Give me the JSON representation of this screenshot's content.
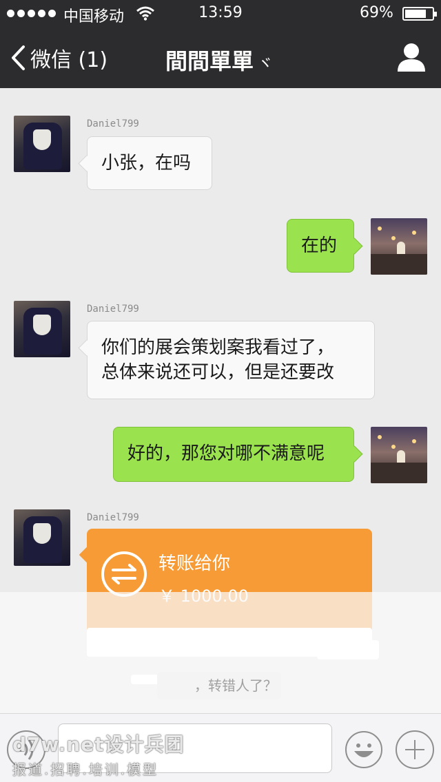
{
  "status_bar": {
    "carrier": "中国移动",
    "time": "13:59",
    "battery": "69%",
    "battery_level": 0.69,
    "icons": [
      "signal-dots-icon",
      "wifi-icon",
      "battery-icon"
    ]
  },
  "nav": {
    "back_label": "微信 (1)",
    "title": "間間單單",
    "title_suffix": "ヾ",
    "icons": [
      "chevron-left-icon",
      "profile-icon"
    ]
  },
  "messages": [
    {
      "sender": "Daniel799",
      "text": "小张，在吗",
      "direction": "in"
    },
    {
      "text": "在的",
      "direction": "out"
    },
    {
      "sender": "Daniel799",
      "text_lines": [
        "你们的展会策划案我看过了，",
        "总体来说还可以，但是还要改"
      ],
      "direction": "in"
    },
    {
      "text": "好的，那您对哪不满意呢",
      "direction": "out"
    },
    {
      "sender": "Daniel799",
      "type": "transfer",
      "label": "转账给你",
      "amount": "￥ 1000.00",
      "direction": "in"
    }
  ],
  "partial_message": "，转错人了？",
  "input_bar": {
    "placeholder": "",
    "icons": [
      "voice-icon",
      "emoji-icon",
      "plus-icon"
    ]
  },
  "watermark": {
    "line1": "d7w.net设计兵团",
    "line2": "报道.招聘.培训.模型"
  },
  "colors": {
    "bar_bg": "#2c2c2e",
    "chat_bg": "#ebebeb",
    "outgoing_bubble": "#9be24f",
    "incoming_bubble": "#f9f9f9",
    "transfer": "#f79b36"
  }
}
